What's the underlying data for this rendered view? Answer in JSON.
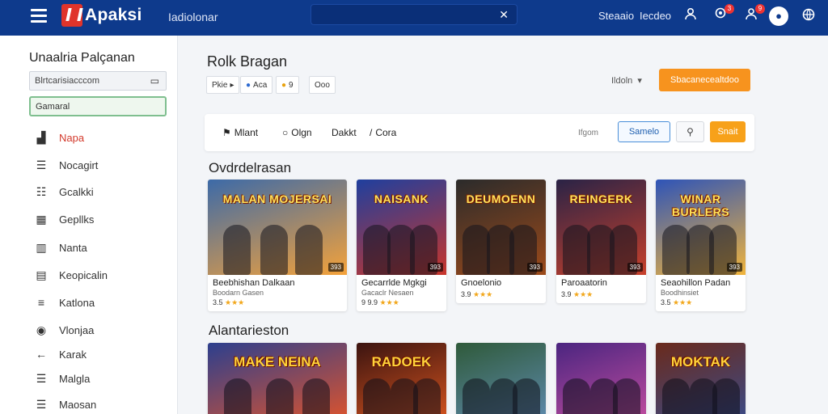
{
  "header": {
    "logo_text": "Apaksi",
    "nav_label": "Iadiolonar",
    "links": [
      "Steaaio",
      "Iecdeo"
    ],
    "notification_counts": [
      "3",
      "9"
    ],
    "icons": [
      "menu-icon",
      "close-x-icon",
      "user-icon",
      "location-icon",
      "bell-icon",
      "account-icon",
      "globe-icon"
    ]
  },
  "sidebar": {
    "title": "Unaalria Palçanan",
    "input_value": "Blrtcarisiacccom",
    "field_value": "Gamaral",
    "items": [
      {
        "label": "Napa",
        "icon": "gamepad-icon",
        "active": true
      },
      {
        "label": "Nocagirt",
        "icon": "list-icon",
        "active": false
      },
      {
        "label": "Gcalkki",
        "icon": "grid-list-icon",
        "active": false
      },
      {
        "label": "Gepllks",
        "icon": "tiles-icon",
        "active": false
      },
      {
        "label": "Nanta",
        "icon": "columns-icon",
        "active": false
      },
      {
        "label": "Keopicalin",
        "icon": "window-icon",
        "active": false
      },
      {
        "label": "Katlona",
        "icon": "sliders-icon",
        "active": false
      },
      {
        "label": "Vlonjaa",
        "icon": "eye-icon",
        "active": false
      },
      {
        "label": "Karak",
        "icon": "arrow-left-icon",
        "active": false
      },
      {
        "label": "Malgla",
        "icon": "lines-icon",
        "active": false
      },
      {
        "label": "Maosan",
        "icon": "lines-icon",
        "active": false
      }
    ]
  },
  "main": {
    "page_title": "Rolk Bragan",
    "chips": [
      "Pkie",
      "Aca",
      "9",
      "Ooo"
    ],
    "sort_label": "Ildoln",
    "primary_button": "Sbacanecealtdoo",
    "filter_tabs": [
      "Mlant",
      "Olgn",
      "Dakkt",
      "Cora"
    ],
    "filter_meta": "Ifgom",
    "filter_outline_button": "Samelo",
    "filter_orange_button": "Snait"
  },
  "sections": [
    {
      "title": "Ovdrdelrasan",
      "cards": [
        {
          "art_title": "MALAN MOJERSAI",
          "name": "Beebhishan Dalkaan",
          "sub": "Boodarn Gasen",
          "rating": "3.5",
          "age": "393",
          "colors": [
            "#3c6aa8",
            "#f4a23a"
          ]
        },
        {
          "art_title": "NAISANK",
          "name": "Gecarrlde Mgkgi",
          "sub": "Gacaclr Nesaen",
          "rating": "9 9.9",
          "age": "393",
          "colors": [
            "#1f3f9e",
            "#c8352b"
          ]
        },
        {
          "art_title": "DEUMOENN",
          "name": "Gnoelonio",
          "sub": "",
          "rating": "3.9",
          "age": "393",
          "colors": [
            "#2b2b2b",
            "#9c4a1a"
          ]
        },
        {
          "art_title": "REINGERK",
          "name": "Paroaatorin",
          "sub": "",
          "rating": "3.9",
          "age": "393",
          "colors": [
            "#2a2346",
            "#c7402b"
          ]
        },
        {
          "art_title": "WINAR BURLERS",
          "name": "Seaohillon Padan",
          "sub": "Boodhinsiet",
          "rating": "3.5",
          "age": "393",
          "colors": [
            "#2e54b8",
            "#f0b43c"
          ]
        }
      ]
    },
    {
      "title": "Alantarieston",
      "cards": [
        {
          "art_title": "MAKE NEINA",
          "colors": [
            "#2c3f8e",
            "#e0542b"
          ]
        },
        {
          "art_title": "RADOEK",
          "colors": [
            "#3b1410",
            "#d9551f"
          ]
        },
        {
          "art_title": "",
          "colors": [
            "#2f5a3a",
            "#5f8bb0"
          ]
        },
        {
          "art_title": "",
          "colors": [
            "#4b2580",
            "#c44ea0"
          ]
        },
        {
          "art_title": "MOKTAK",
          "colors": [
            "#6a2a1c",
            "#3a4c8a"
          ]
        }
      ]
    }
  ],
  "colors": {
    "header_bg": "#0e3a8c",
    "accent_orange": "#f7931e",
    "active_red": "#d33a2c"
  }
}
